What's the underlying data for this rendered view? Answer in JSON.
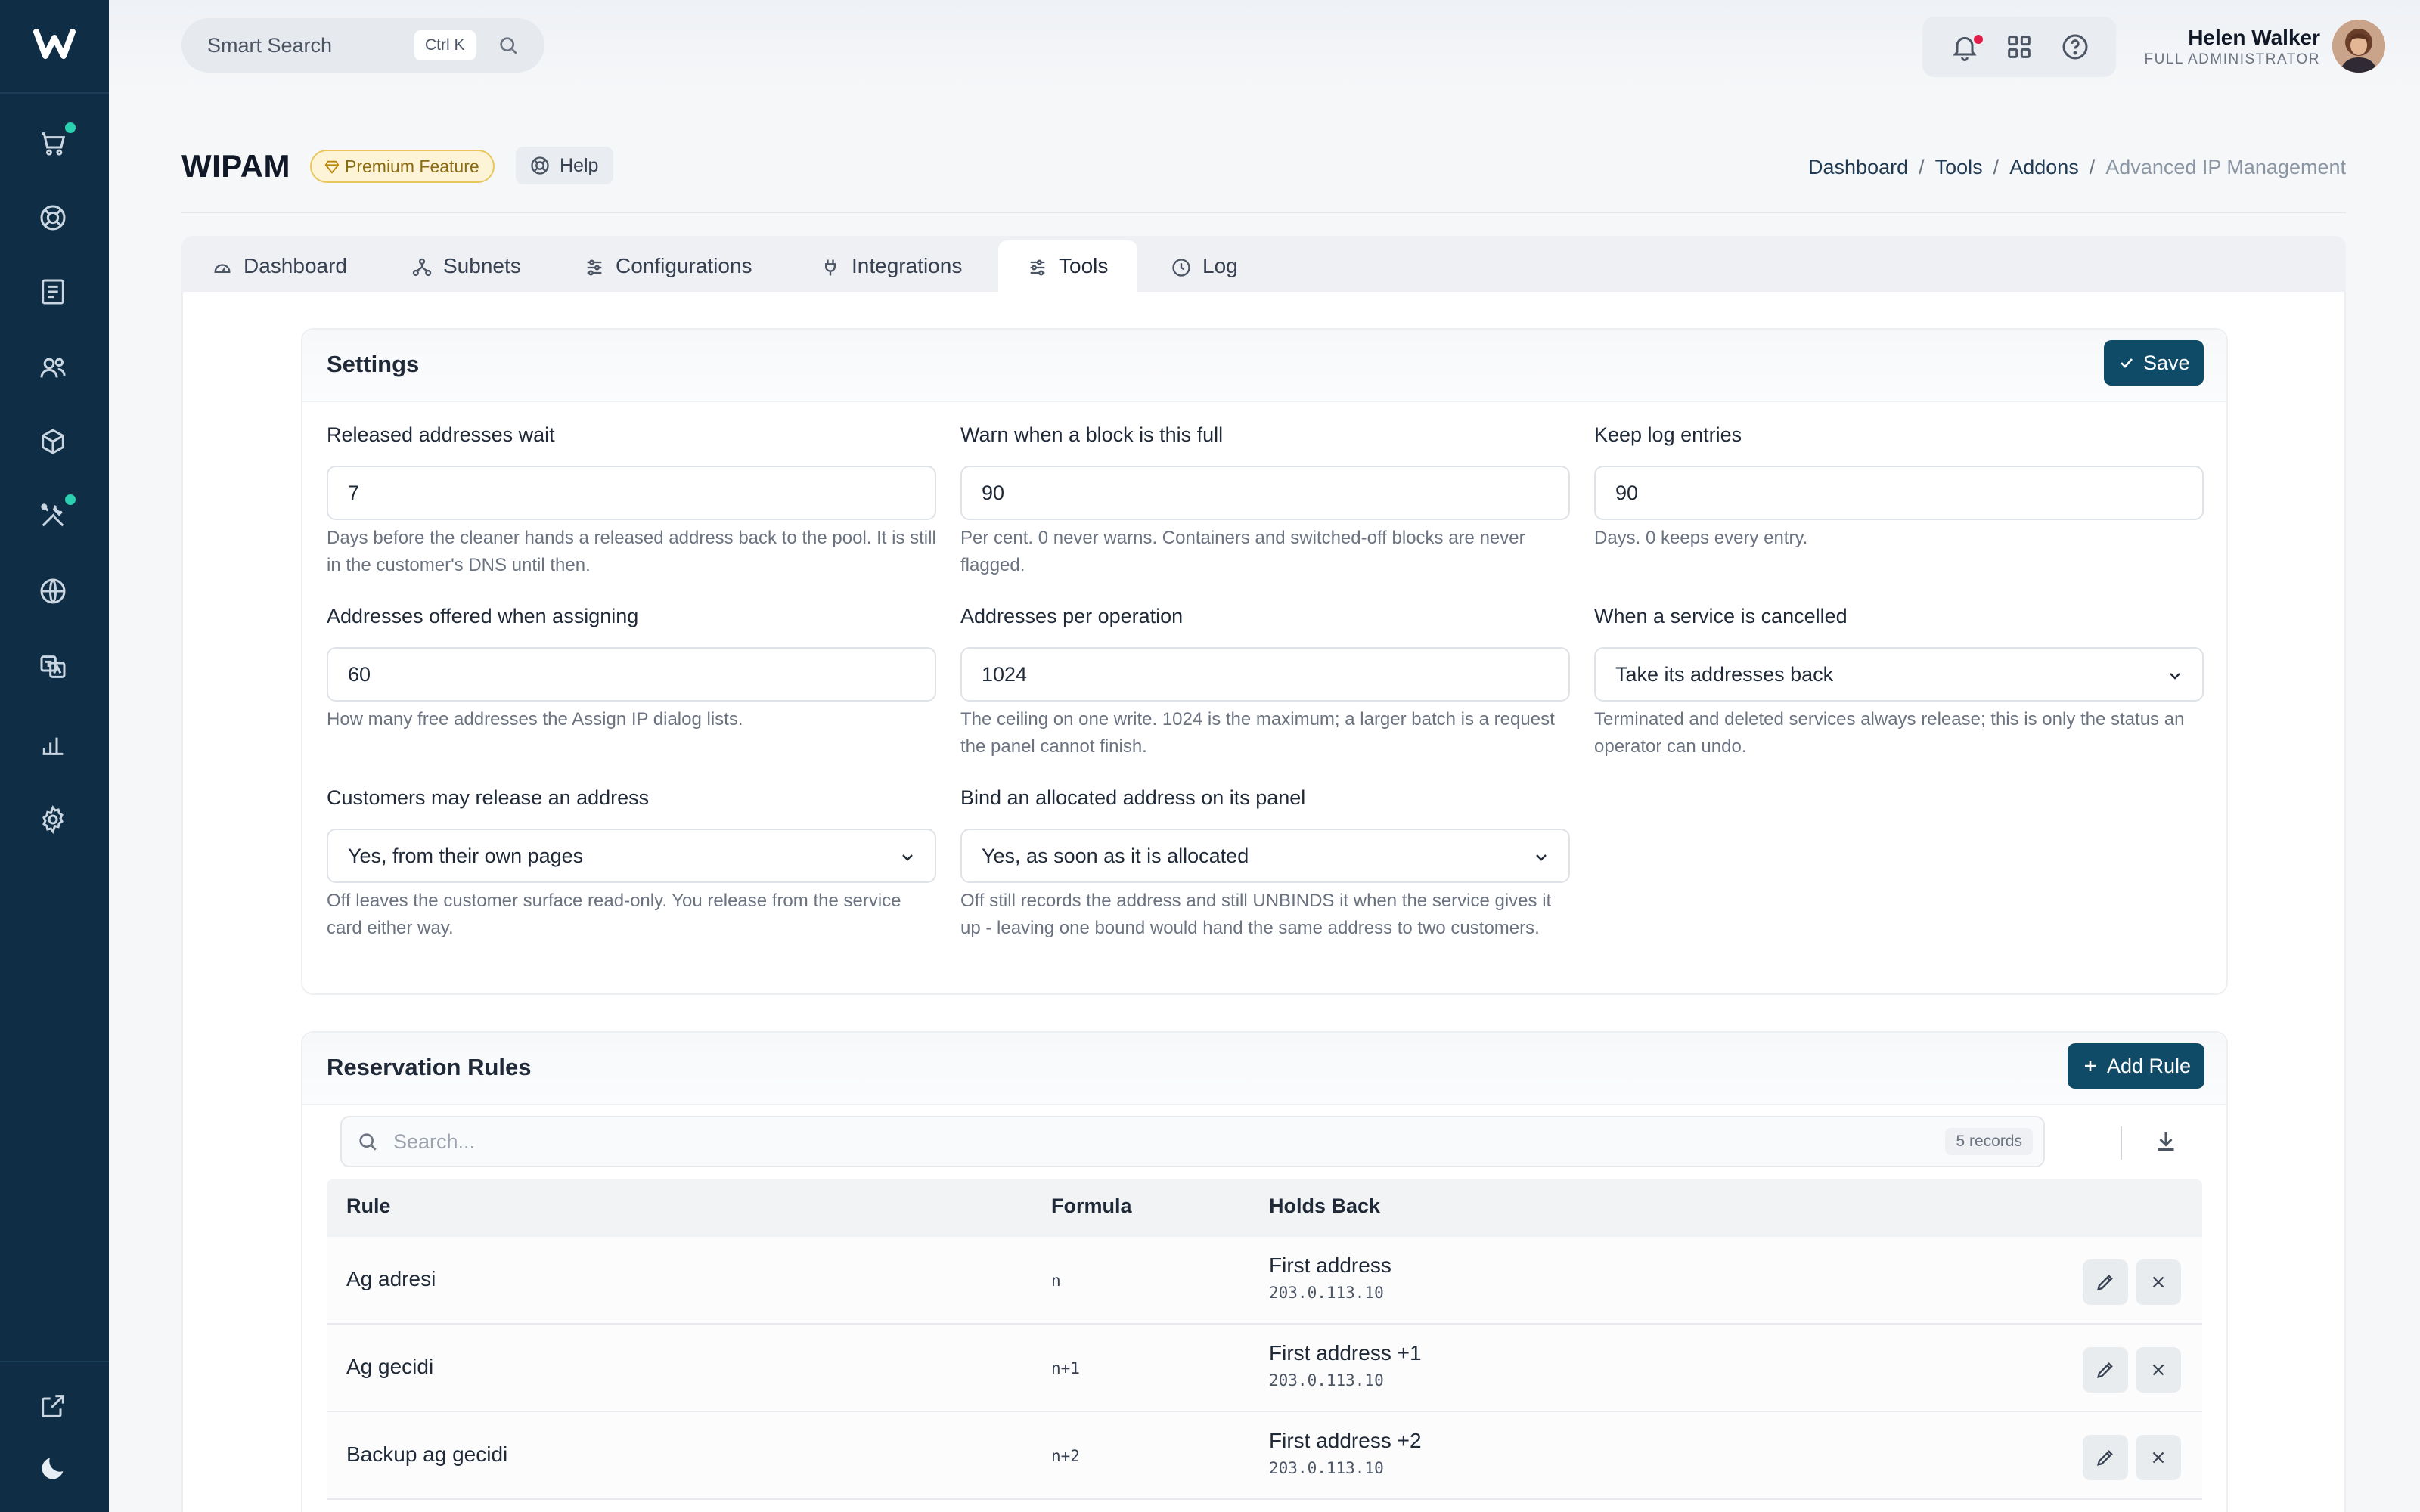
{
  "app": {
    "logo_letter": "W"
  },
  "topbar": {
    "search_placeholder": "Smart Search",
    "search_shortcut": "Ctrl K",
    "user_name": "Helen Walker",
    "user_role": "FULL ADMINISTRATOR"
  },
  "page": {
    "title": "WIPAM",
    "premium_label": "Premium Feature",
    "help_label": "Help"
  },
  "breadcrumb": [
    "Dashboard",
    "Tools",
    "Addons",
    "Advanced IP Management"
  ],
  "tabs": [
    {
      "label": "Dashboard",
      "icon": "gauge-icon"
    },
    {
      "label": "Subnets",
      "icon": "network-icon"
    },
    {
      "label": "Configurations",
      "icon": "sliders-icon"
    },
    {
      "label": "Integrations",
      "icon": "plug-icon"
    },
    {
      "label": "Tools",
      "icon": "tools-icon",
      "active": true
    },
    {
      "label": "Log",
      "icon": "clock-icon"
    }
  ],
  "settings": {
    "title": "Settings",
    "save_label": "Save",
    "fields": [
      {
        "label": "Released addresses wait",
        "value": "7",
        "hint": "Days before the cleaner hands a released address back to the pool. It is still in the customer's DNS until then."
      },
      {
        "label": "Warn when a block is this full",
        "value": "90",
        "hint": "Per cent. 0 never warns. Containers and switched-off blocks are never flagged."
      },
      {
        "label": "Keep log entries",
        "value": "90",
        "hint": "Days. 0 keeps every entry."
      },
      {
        "label": "Addresses offered when assigning",
        "value": "60",
        "hint": "How many free addresses the Assign IP dialog lists."
      },
      {
        "label": "Addresses per operation",
        "value": "1024",
        "hint": "The ceiling on one write. 1024 is the maximum; a larger batch is a request the panel cannot finish."
      },
      {
        "label": "When a service is cancelled",
        "value": "Take its addresses back",
        "hint": "Terminated and deleted services always release; this is only the status an operator can undo."
      },
      {
        "label": "Customers may release an address",
        "value": "Yes, from their own pages",
        "hint": "Off leaves the customer surface read-only. You release from the service card either way."
      },
      {
        "label": "Bind an allocated address on its panel",
        "value": "Yes, as soon as it is allocated",
        "hint": "Off still records the address and still UNBINDS it when the service gives it up - leaving one bound would hand the same address to two customers."
      }
    ]
  },
  "rules": {
    "title": "Reservation Rules",
    "add_label": "Add Rule",
    "search_placeholder": "Search...",
    "records_label": "5 records",
    "columns": [
      "Rule",
      "Formula",
      "Holds Back"
    ],
    "rows": [
      {
        "rule": "Ag adresi",
        "formula": "n",
        "holds": "First address",
        "ip": "203.0.113.10"
      },
      {
        "rule": "Ag gecidi",
        "formula": "n+1",
        "holds": "First address +1",
        "ip": "203.0.113.10"
      },
      {
        "rule": "Backup ag gecidi",
        "formula": "n+2",
        "holds": "First address +2",
        "ip": "203.0.113.10"
      }
    ]
  },
  "colors": {
    "sidebar": "#0f2d44",
    "primary": "#0f4a66",
    "badge_dot": "#2ad0b0",
    "notif_dot": "#e11d48"
  }
}
